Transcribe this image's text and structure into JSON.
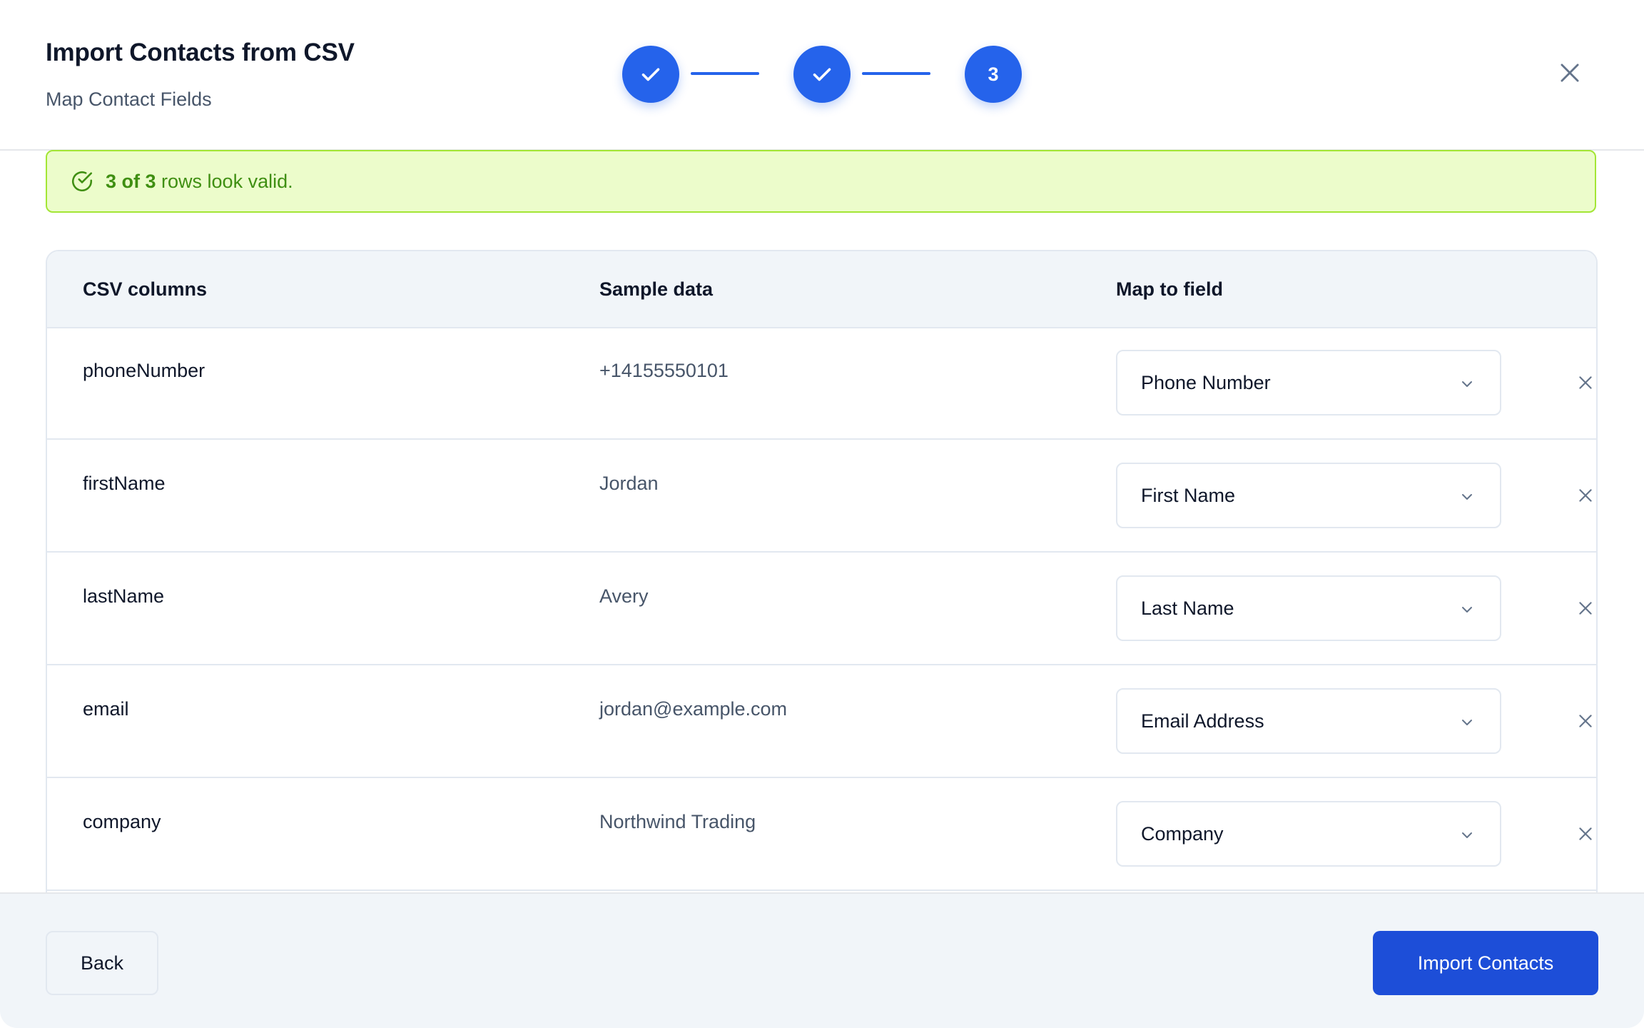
{
  "header": {
    "title": "Import Contacts from CSV",
    "subtitle": "Map Contact Fields"
  },
  "stepper": {
    "current_step": 3,
    "steps": [
      {
        "state": "complete",
        "icon": "check-icon"
      },
      {
        "state": "complete",
        "icon": "check-icon"
      },
      {
        "state": "current",
        "label": "3"
      }
    ]
  },
  "banner": {
    "highlight": "3 of 3",
    "text": " rows look valid.",
    "icon": "check-circle-icon"
  },
  "table": {
    "headers": {
      "csv_columns": "CSV columns",
      "sample_data": "Sample data",
      "map_to_field": "Map to field"
    },
    "rows": [
      {
        "column": "phoneNumber",
        "sample": "+14155550101",
        "mapped_field": "Phone Number"
      },
      {
        "column": "firstName",
        "sample": "Jordan",
        "mapped_field": "First Name"
      },
      {
        "column": "lastName",
        "sample": "Avery",
        "mapped_field": "Last Name"
      },
      {
        "column": "email",
        "sample": "jordan@example.com",
        "mapped_field": "Email Address"
      },
      {
        "column": "company",
        "sample": "Northwind Trading",
        "mapped_field": "Company"
      }
    ]
  },
  "footer": {
    "back_label": "Back",
    "import_label": "Import Contacts"
  },
  "colors": {
    "primary": "#2563eb",
    "primary_dark": "#1d4ed8",
    "success_bg": "#ecfccb",
    "success_border": "#a3e635",
    "success_text": "#3f8f12"
  }
}
